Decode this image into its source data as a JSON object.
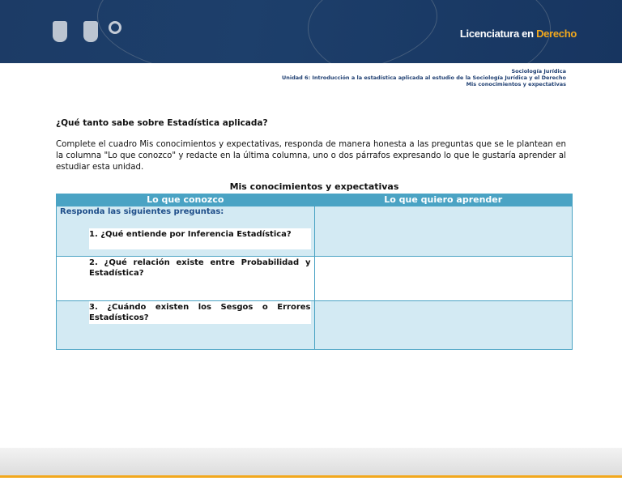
{
  "header": {
    "brand_prefix": "Licenciatura en ",
    "brand_highlight": "Derecho",
    "logos": [
      "unam-logo",
      "fes-logo",
      "cuaed-logo"
    ]
  },
  "subheader": {
    "subject": "Sociología Jurídica",
    "unit": "Unidad 6: Introducción  a la estadística aplicada al estudio de la Sociología Jurídica  y el Derecho",
    "activity": "Mis conocimientos y expectativas"
  },
  "question_title": "¿Qué tanto sabe sobre Estadística aplicada?",
  "instructions": "Complete el cuadro Mis conocimientos y expectativas, responda de manera honesta a las preguntas que se le plantean en la columna \"Lo que conozco\" y redacte en la última columna, uno o dos párrafos expresando lo que le gustaría aprender al estudiar esta unidad.",
  "table": {
    "title": "Mis conocimientos y expectativas",
    "headers": [
      "Lo que conozco",
      "Lo que quiero aprender"
    ],
    "lead": "Responda las siguientes preguntas:",
    "questions": [
      "1. ¿Qué entiende por Inferencia Estadística?",
      "2. ¿Qué relación existe entre Probabilidad y Estadística?",
      "3. ¿Cuándo existen los Sesgos o Errores Estadísticos?"
    ],
    "answers": [
      "",
      "",
      ""
    ]
  },
  "colors": {
    "banner": "#1c3b66",
    "accent": "#f2a81d",
    "table_header": "#4aa3c4",
    "table_row": "#d3eaf3"
  }
}
